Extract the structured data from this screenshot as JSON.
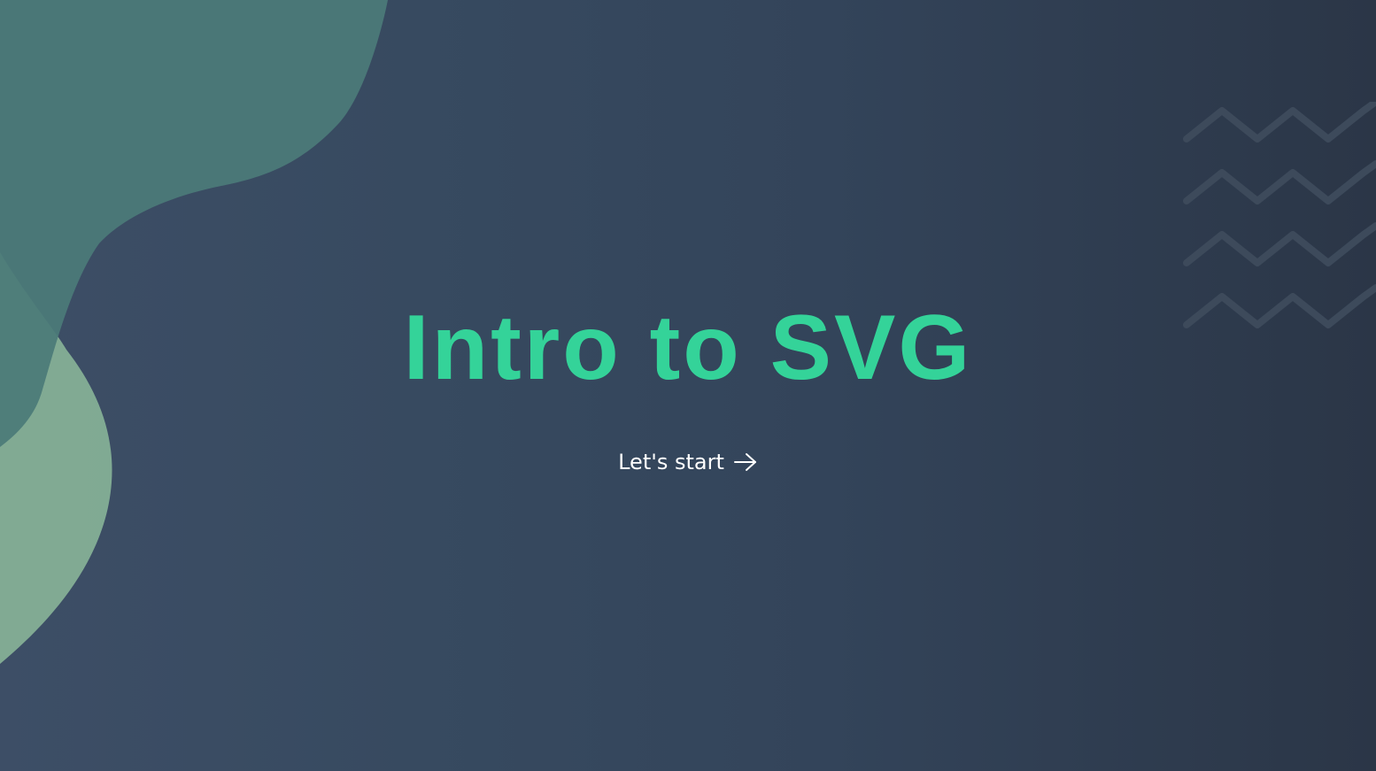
{
  "hero": {
    "title": "Intro to SVG",
    "cta_label": "Let's start"
  },
  "icons": {
    "cta": "arrow-right-icon",
    "decoration": "zigzag-pattern-icon"
  },
  "colors": {
    "background_left": "#3d4e66",
    "background_right": "#2b3647",
    "title": "#34d399",
    "cta_text": "#ffffff",
    "blob_teal": "#4b7b79",
    "blob_sage": "#88b598",
    "zigzag": "#3d4a5b"
  }
}
